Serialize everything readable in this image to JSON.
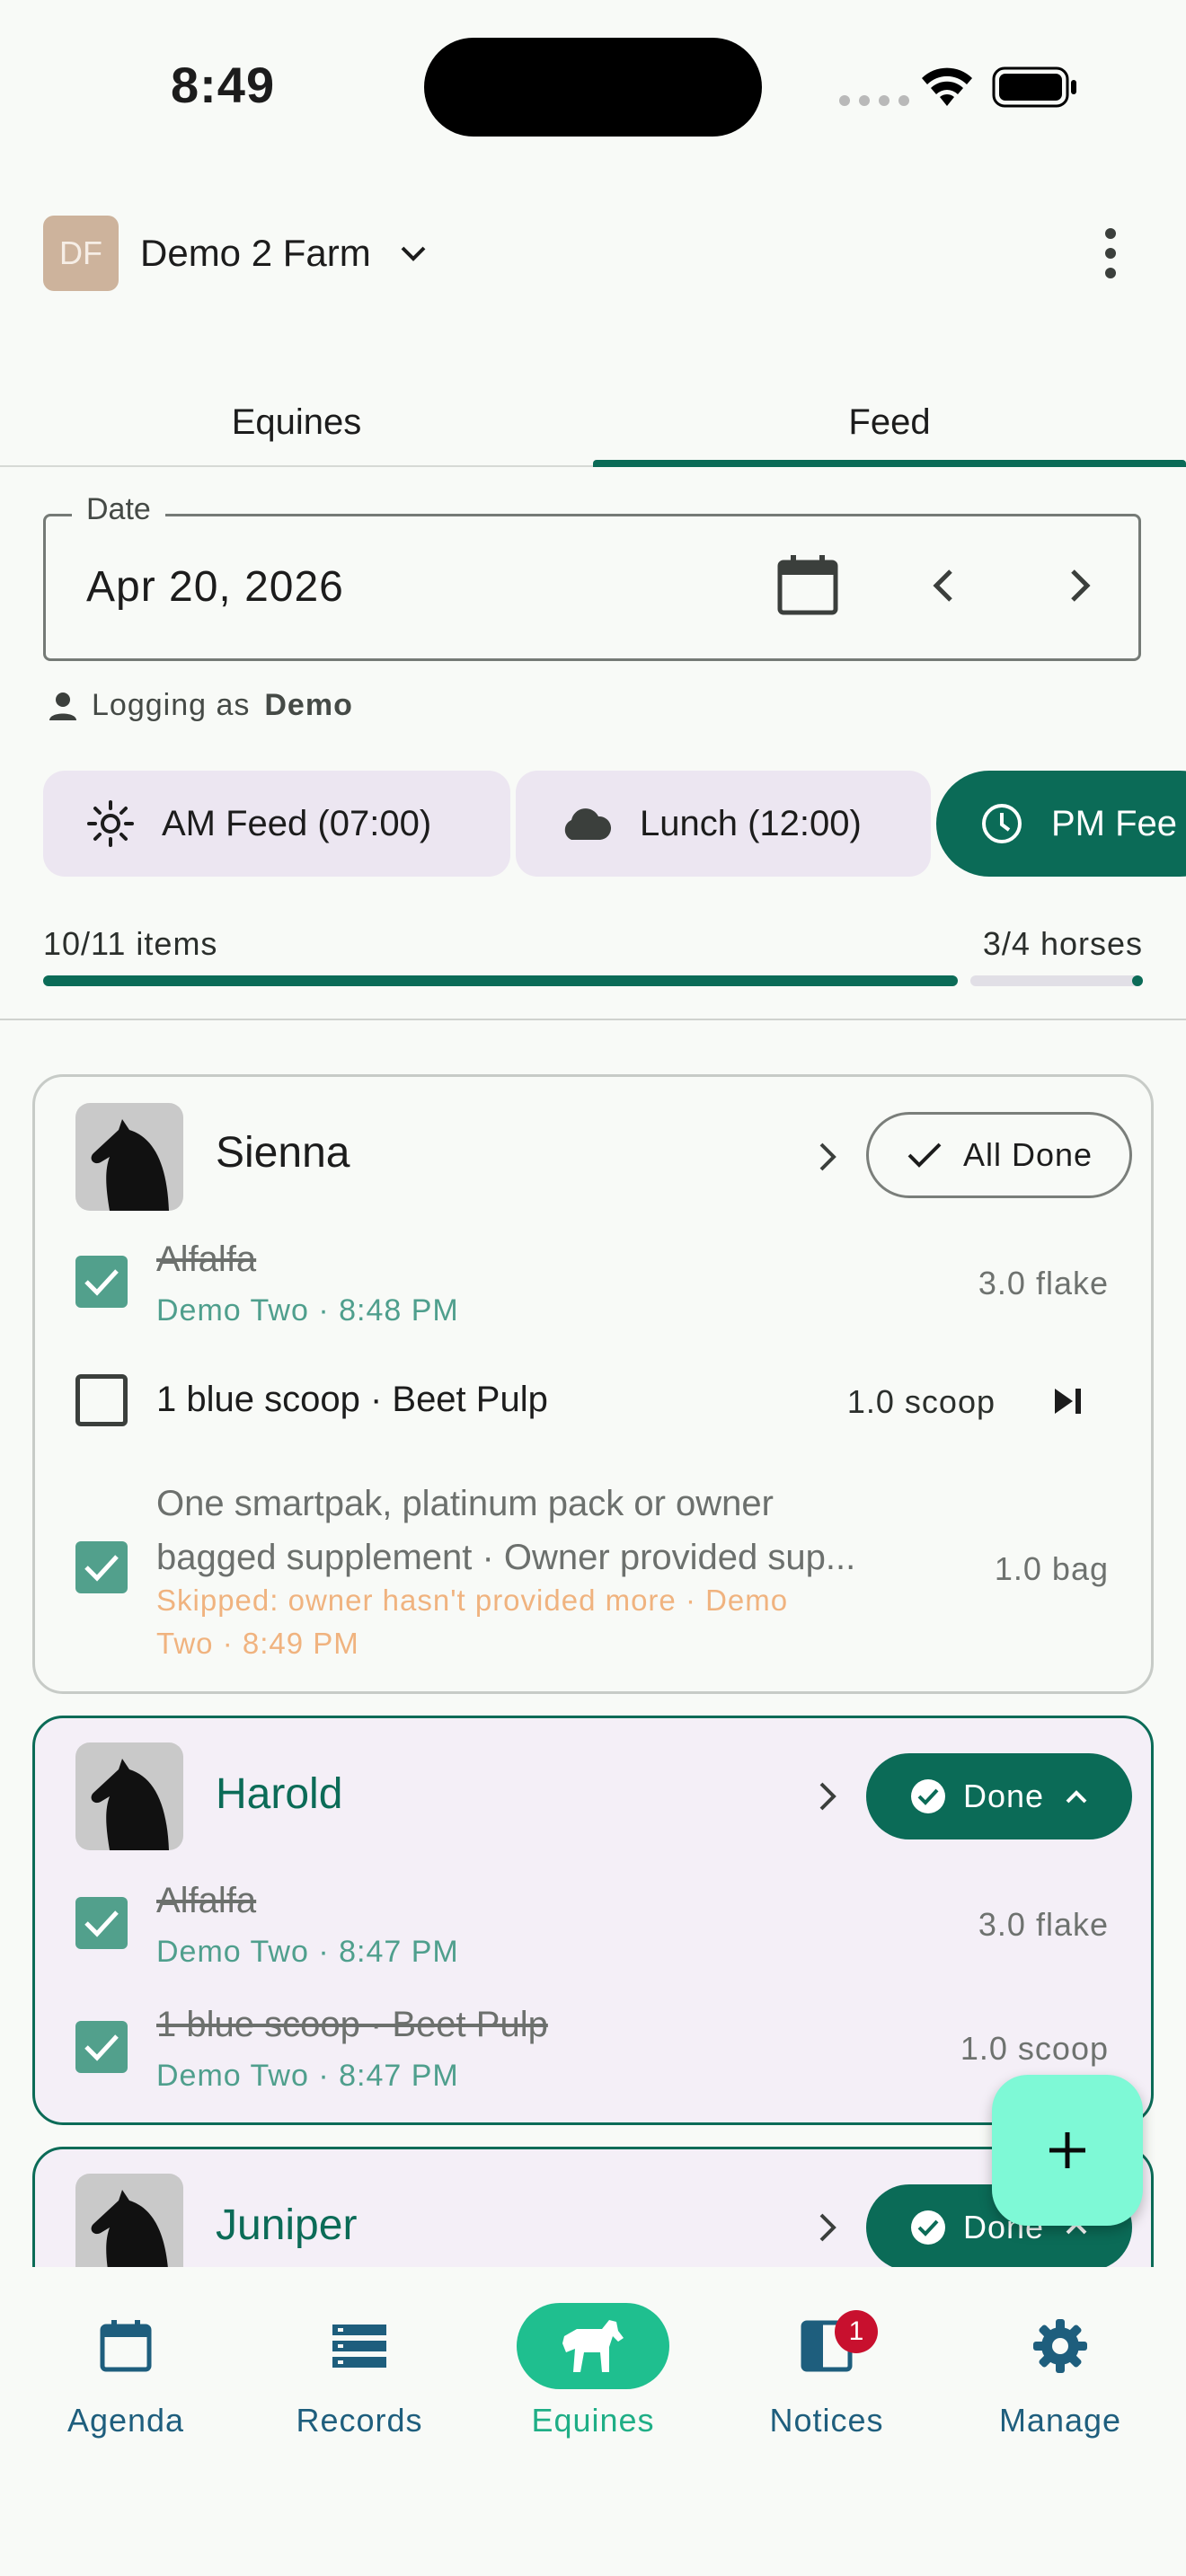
{
  "status_bar": {
    "time": "8:49"
  },
  "header": {
    "farm_initials": "DF",
    "farm_name": "Demo 2 Farm"
  },
  "tabs": [
    {
      "label": "Equines"
    },
    {
      "label": "Feed",
      "selected": true
    }
  ],
  "date_field": {
    "label": "Date",
    "value": "Apr 20, 2026"
  },
  "logging": {
    "prefix": "Logging as",
    "user": "Demo"
  },
  "feed_chips": [
    {
      "label": "AM Feed (07:00)",
      "icon": "sun-icon"
    },
    {
      "label": "Lunch (12:00)",
      "icon": "cloud-icon"
    },
    {
      "label": "PM Fee",
      "icon": "clock-icon",
      "selected": true
    }
  ],
  "progress": {
    "items_text": "10/11 items",
    "horses_text": "3/4 horses",
    "fraction": 0.909
  },
  "colors": {
    "primary": "#0b6b57",
    "accent": "#7ef9d6",
    "checked": "#52a08c",
    "skipped": "#f0b37f",
    "badge": "#c8102e"
  },
  "horses": [
    {
      "name": "Sienna",
      "action": "All Done",
      "items": [
        {
          "title": "Alfalfa",
          "sub": "Demo Two · 8:48 PM",
          "amount": "3.0 flake",
          "checked": true
        },
        {
          "title": "1 blue scoop · Beet Pulp",
          "amount": "1.0 scoop",
          "checked": false
        },
        {
          "title_line1": "One smartpak, platinum pack or owner",
          "title_line2": "bagged supplement · Owner provided sup...",
          "skip_line1": "Skipped: owner hasn't provided more · Demo",
          "skip_line2": "Two · 8:49 PM",
          "amount": "1.0 bag",
          "checked": true
        }
      ]
    },
    {
      "name": "Harold",
      "action": "Done",
      "items": [
        {
          "title": "Alfalfa",
          "sub": "Demo Two · 8:47 PM",
          "amount": "3.0 flake",
          "checked": true
        },
        {
          "title": "1 blue scoop · Beet Pulp",
          "sub": "Demo Two · 8:47 PM",
          "amount": "1.0 scoop",
          "checked": true
        }
      ]
    },
    {
      "name": "Juniper",
      "action": "Done"
    }
  ],
  "bottom_nav": [
    {
      "label": "Agenda",
      "icon": "calendar-icon"
    },
    {
      "label": "Records",
      "icon": "list-icon"
    },
    {
      "label": "Equines",
      "icon": "horse-icon",
      "active": true
    },
    {
      "label": "Notices",
      "icon": "notice-icon",
      "badge": "1"
    },
    {
      "label": "Manage",
      "icon": "gear-icon"
    }
  ]
}
